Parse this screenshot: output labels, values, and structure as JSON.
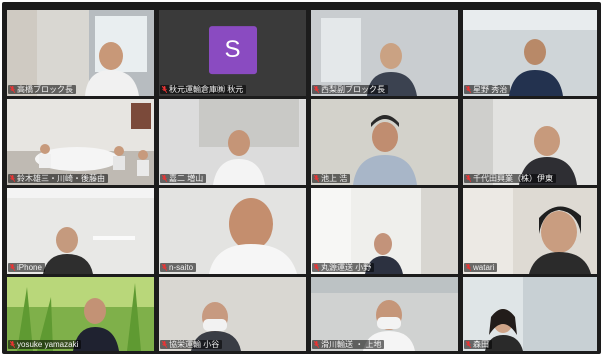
{
  "app": {
    "brand_color": "#8a4bc1",
    "muted_icon": "mic-muted-icon"
  },
  "tiles": [
    {
      "name": "高橋ブロック長"
    },
    {
      "name": "秋元運輸倉庫㈱ 秋元",
      "avatar_letter": "S"
    },
    {
      "name": "西梨副ブロック長"
    },
    {
      "name": "星野 秀治"
    },
    {
      "name": "鈴木雄三・川崎・後藤由"
    },
    {
      "name": "嘉二 増山"
    },
    {
      "name": "池上 浩"
    },
    {
      "name": "千代田興業（株）伊東"
    },
    {
      "name": "iPhone"
    },
    {
      "name": "n-saito"
    },
    {
      "name": "丸源運送 小野"
    },
    {
      "name": "watari"
    },
    {
      "name": "yosuke yamazaki"
    },
    {
      "name": "協栄運輸 小谷"
    },
    {
      "name": "滑川輸送 ・ 上地"
    },
    {
      "name": "森田"
    }
  ]
}
